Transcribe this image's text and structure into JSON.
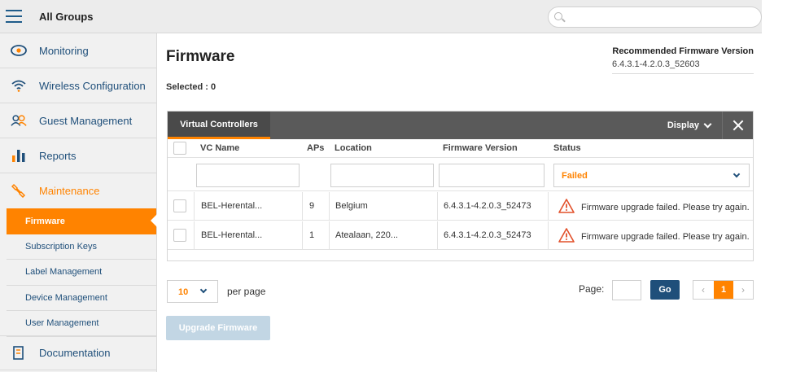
{
  "header": {
    "title": "All Groups",
    "menu_icon": "hamburger-icon",
    "search_placeholder": "",
    "search_icon": "search-icon"
  },
  "sidebar": {
    "items": [
      {
        "label": "Monitoring",
        "icon": "eye-icon"
      },
      {
        "label": "Wireless Configuration",
        "icon": "wifi-icon"
      },
      {
        "label": "Guest Management",
        "icon": "users-icon"
      },
      {
        "label": "Reports",
        "icon": "bar-chart-icon"
      },
      {
        "label": "Maintenance",
        "icon": "wrench-icon"
      }
    ],
    "subitems": [
      "Firmware",
      "Subscription Keys",
      "Label Management",
      "Device Management",
      "User Management"
    ],
    "documentation": {
      "label": "Documentation",
      "icon": "document-icon"
    }
  },
  "main": {
    "title": "Firmware",
    "recommended_title": "Recommended Firmware Version",
    "recommended_value": "6.4.3.1-4.2.0.3_52603",
    "selected": "Selected : 0"
  },
  "grid": {
    "tab": "Virtual Controllers",
    "display_label": "Display",
    "columns": [
      "VC Name",
      "APs",
      "Location",
      "Firmware Version",
      "Status"
    ],
    "status_filter": "Failed",
    "rows": [
      {
        "name": "BEL-Herental...",
        "aps": "9",
        "location": "Belgium",
        "firmware": "6.4.3.1-4.2.0.3_52473",
        "status": "Firmware upgrade failed. Please try again."
      },
      {
        "name": "BEL-Herental...",
        "aps": "1",
        "location": "Atealaan, 220...",
        "firmware": "6.4.3.1-4.2.0.3_52473",
        "status": "Firmware upgrade failed. Please try again."
      }
    ]
  },
  "pagination": {
    "per_page_value": "10",
    "per_page_label": "per page",
    "page_label": "Page:",
    "go_label": "Go",
    "current_page": "1",
    "prev": "‹",
    "next": "›"
  },
  "actions": {
    "upgrade": "Upgrade Firmware"
  },
  "colors": {
    "accent": "#ff8300",
    "nav_text": "#1f4f7a",
    "grid_header": "#5a5a5a",
    "warning": "#e2502a"
  }
}
